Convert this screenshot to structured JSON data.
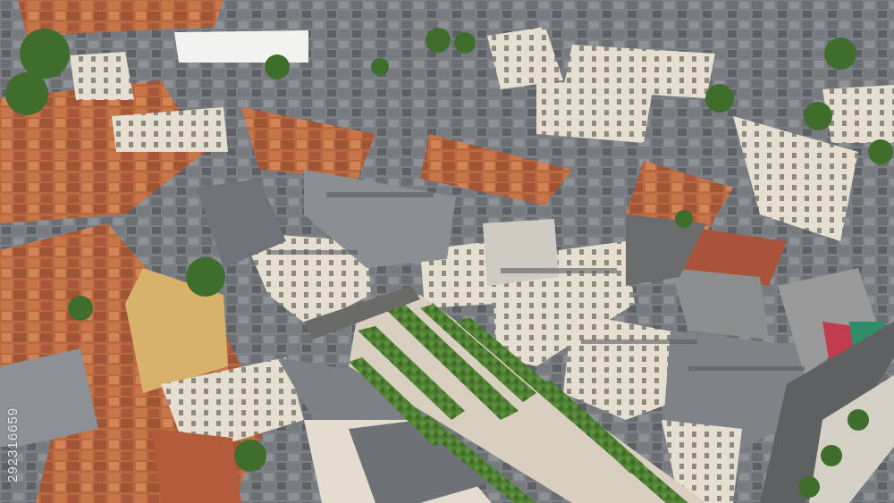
{
  "photo": {
    "watermark_id": "292316659"
  },
  "colors": {
    "slate_roof": "#6f7378",
    "terracotta_roof": "#c0623c",
    "facade": "#e4ddcf",
    "park_gravel": "#d9cfc0",
    "hedge": "#4b7a2f",
    "street": "#6a6a68"
  }
}
